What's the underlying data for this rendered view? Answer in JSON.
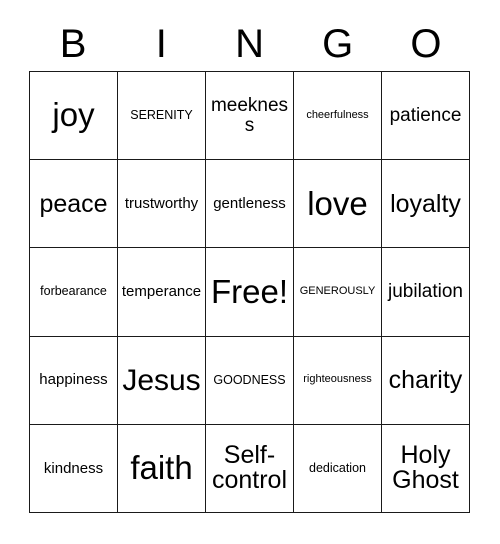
{
  "card": {
    "header_letters": [
      "B",
      "I",
      "N",
      "G",
      "O"
    ],
    "columns": 5,
    "rows": 5,
    "border_color": "#1a1a1a",
    "background_color": "#ffffff",
    "text_color": "#000000",
    "free_space": "Free!",
    "free_space_position": {
      "row": 3,
      "column": 3
    },
    "cells": [
      [
        {
          "text": "joy",
          "size": "xxl"
        },
        {
          "text": "SERENITY",
          "size": "xs"
        },
        {
          "text": "meekness",
          "size": "md"
        },
        {
          "text": "cheerfulness",
          "size": "xxs"
        },
        {
          "text": "patience",
          "size": "md"
        }
      ],
      [
        {
          "text": "peace",
          "size": "lg"
        },
        {
          "text": "trustworthy",
          "size": "sm"
        },
        {
          "text": "gentleness",
          "size": "sm"
        },
        {
          "text": "love",
          "size": "xxl"
        },
        {
          "text": "loyalty",
          "size": "lg"
        }
      ],
      [
        {
          "text": "forbearance",
          "size": "xs"
        },
        {
          "text": "temperance",
          "size": "sm"
        },
        {
          "text": "Free!",
          "size": "xxl"
        },
        {
          "text": "GENEROUSLY",
          "size": "xxs"
        },
        {
          "text": "jubilation",
          "size": "md"
        }
      ],
      [
        {
          "text": "happiness",
          "size": "sm"
        },
        {
          "text": "Jesus",
          "size": "xl"
        },
        {
          "text": "GOODNESS",
          "size": "xs"
        },
        {
          "text": "righteousness",
          "size": "xxs"
        },
        {
          "text": "charity",
          "size": "lg"
        }
      ],
      [
        {
          "text": "kindness",
          "size": "sm"
        },
        {
          "text": "faith",
          "size": "xxl"
        },
        {
          "text": "Self-control",
          "size": "lg"
        },
        {
          "text": "dedication",
          "size": "xs"
        },
        {
          "text": "Holy Ghost",
          "size": "lg"
        }
      ]
    ]
  }
}
